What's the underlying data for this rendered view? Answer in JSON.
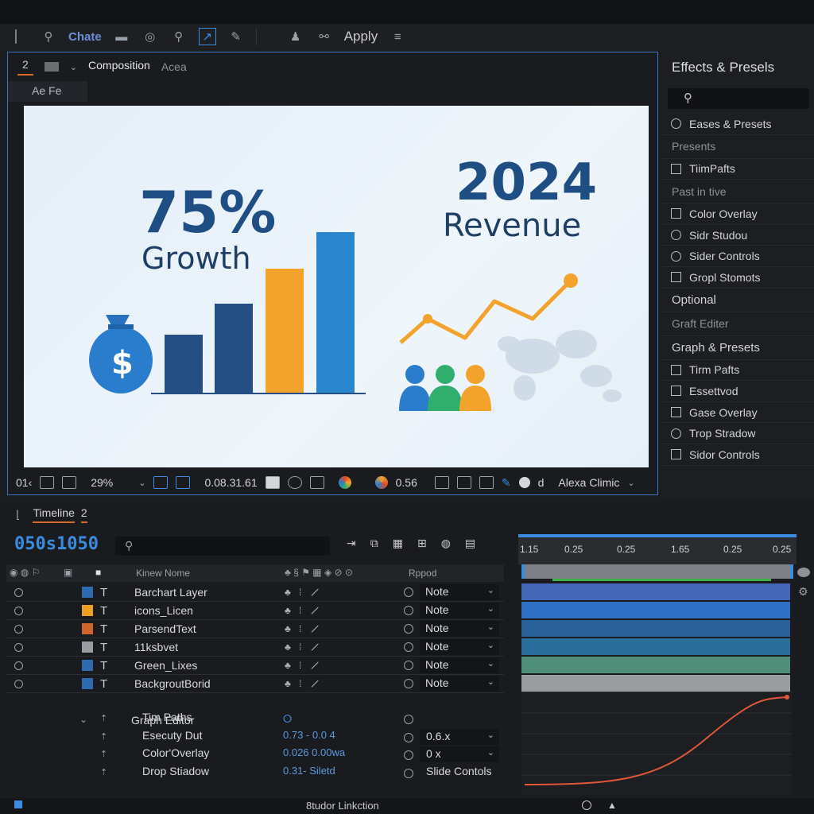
{
  "toolbar": {
    "chate_label": "Chate",
    "apply_label": "Apply"
  },
  "composition": {
    "tab_number": "2",
    "tab_title": "Composition",
    "tab_extra": "Acea",
    "subtab": "Ae Fe",
    "canvas": {
      "growth_value": "75%",
      "growth_label": "Growth",
      "year": "2024",
      "revenue_label": "Revenue",
      "dollar_glyph": "$"
    },
    "bottom": {
      "frame_label": "01‹",
      "zoom": "29%",
      "timecode": "0.08.31.61",
      "exposure": "0.56",
      "view_label": "d",
      "camera": "Alexa Climic"
    }
  },
  "effects_panel": {
    "title": "Effects & Presels",
    "search_placeholder": "",
    "items": [
      {
        "type": "row",
        "icon": "circle-icon",
        "label": "Eases & Presets"
      },
      {
        "type": "head",
        "label": "Presents"
      },
      {
        "type": "row",
        "icon": "grid-icon",
        "label": "TiimPafts"
      },
      {
        "type": "head",
        "label": "Past in tive"
      },
      {
        "type": "row",
        "icon": "square-icon",
        "label": "Color Overlay"
      },
      {
        "type": "row",
        "icon": "circle-icon",
        "label": "Sidr Studou"
      },
      {
        "type": "row",
        "icon": "circle-icon",
        "label": "Sider Controls"
      },
      {
        "type": "row",
        "icon": "square-icon",
        "label": "Gropl Stomots"
      },
      {
        "type": "headbig",
        "label": "Optional"
      },
      {
        "type": "head",
        "label": "Graft Editer"
      },
      {
        "type": "headbig",
        "label": "Graph & Presets"
      },
      {
        "type": "row",
        "icon": "grid-icon",
        "label": "Tirm Pafts"
      },
      {
        "type": "row",
        "icon": "wand-icon",
        "label": "Essettvod"
      },
      {
        "type": "row",
        "icon": "square-icon",
        "label": "Gase Overlay"
      },
      {
        "type": "row",
        "icon": "circle-icon",
        "label": "Trop Stradow"
      },
      {
        "type": "row",
        "icon": "link-icon",
        "label": "Sidor Controls"
      }
    ]
  },
  "timeline": {
    "tab_label": "Timeline",
    "tab_number": "2",
    "timecode": "050s1050",
    "column_name": "Kinew Nome",
    "column_parent": "Rppod",
    "ruler": [
      "1.15",
      "0.25",
      "0.25",
      "1.65",
      "0.25",
      "0.25"
    ],
    "layers": [
      {
        "name": "Barchart Layer",
        "color": "#2f6bb0",
        "parent": "Note",
        "track": "#4467b8"
      },
      {
        "name": "icons_Licen",
        "color": "#f0a020",
        "parent": "Note",
        "track": "#2f6fc4"
      },
      {
        "name": "ParsendText",
        "color": "#d0642a",
        "parent": "Note",
        "track": "#2a5f9a"
      },
      {
        "name": "11ksbvet",
        "color": "#9a9ea4",
        "parent": "Note",
        "track": "#2a6f9a"
      },
      {
        "name": "Green_Lixes",
        "color": "#2f6bb0",
        "parent": "Note",
        "track": "#4f8f7a"
      },
      {
        "name": "BackgroutBorid",
        "color": "#2f6bb0",
        "parent": "Note",
        "track": "#9a9ca0"
      }
    ],
    "graph_editor_label": "Graph Editor",
    "graph_rows": [
      {
        "label": "Tim Paths",
        "value": "",
        "select": ""
      },
      {
        "label": "Esecuty Dut",
        "value": "0.73 - 0.0 4",
        "select": "0.6.x"
      },
      {
        "label": "Color'Overlay",
        "value": "0.026 0.00wa",
        "select": "0 x"
      },
      {
        "label": "Drop Stiadow",
        "value": "0.31- Siletd",
        "select": "Slide Contols"
      }
    ],
    "status_label": "8tudor Linkction"
  },
  "colors": {
    "accent_blue": "#3b8ce0",
    "tab_underline": "#d8692c",
    "panel_border": "#3a73c4",
    "curve": "#e0573a"
  }
}
